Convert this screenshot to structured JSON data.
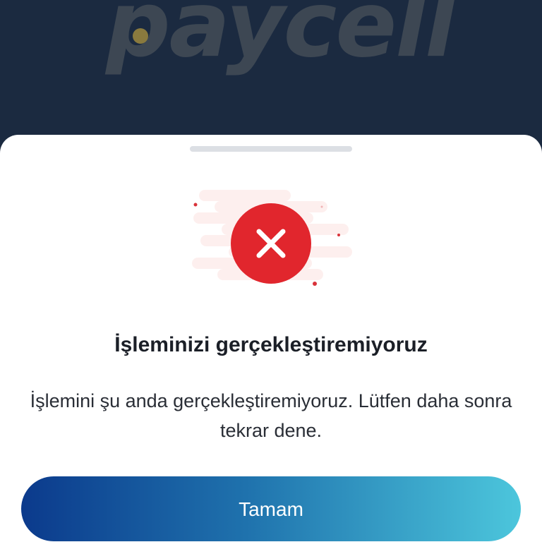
{
  "app": {
    "logo_text": "paycell",
    "logo_dot_color": "#8a7a3e",
    "header_color": "#1b2a40"
  },
  "dialog": {
    "icon": "error-x-icon",
    "icon_color": "#e1262d",
    "title": "İşleminizi gerçekleştiremiyoruz",
    "message": "İşlemini şu anda gerçekleştiremiyoruz. Lütfen daha sonra tekrar dene.",
    "button_label": "Tamam",
    "button_gradient": [
      "#0b3a8c",
      "#4cc6dc"
    ]
  }
}
